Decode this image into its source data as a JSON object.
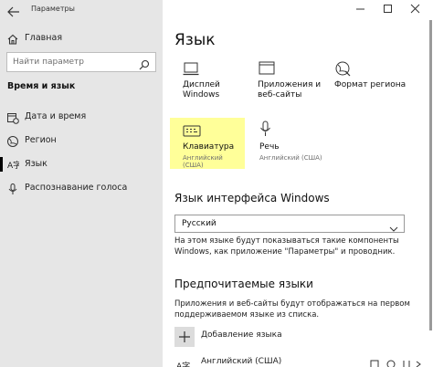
{
  "window": {
    "title": "Параметры",
    "controls": {
      "minimize": "minimize-icon",
      "maximize": "maximize-icon",
      "close": "close-icon"
    }
  },
  "sidebar": {
    "home_label": "Главная",
    "search_placeholder": "Найти параметр",
    "section_title": "Время и язык",
    "items": [
      {
        "label": "Дата и время",
        "icon": "calendar-clock-icon"
      },
      {
        "label": "Регион",
        "icon": "globe-icon"
      },
      {
        "label": "Язык",
        "icon": "language-icon",
        "active": true
      },
      {
        "label": "Распознавание голоса",
        "icon": "microphone-icon"
      }
    ]
  },
  "main": {
    "title": "Язык",
    "tiles": [
      {
        "label": "Дисплей Windows",
        "sub": "",
        "icon": "monitor-icon"
      },
      {
        "label": "Приложения и веб-сайты",
        "sub": "",
        "icon": "app-window-icon"
      },
      {
        "label": "Формат региона",
        "sub": "",
        "icon": "region-globe-icon"
      },
      {
        "label": "Клавиатура",
        "sub": "Английский (США)",
        "icon": "keyboard-icon",
        "highlighted": true
      },
      {
        "label": "Речь",
        "sub": "Английский (США)",
        "icon": "microphone-icon"
      }
    ],
    "ui_lang_title": "Язык интерфейса Windows",
    "ui_lang_value": "Русский",
    "ui_lang_desc": "На этом языке будут показываться такие компоненты Windows, как приложение \"Параметры\" и проводник.",
    "preferred_title": "Предпочитаемые языки",
    "preferred_desc": "Приложения и веб-сайты будут отображаться на первом поддерживаемом языке из списка.",
    "add_label": "Добавление языка",
    "languages": [
      {
        "label": "Английский (США)"
      }
    ]
  },
  "colors": {
    "sidebar_bg": "#e6e6e6",
    "highlight": "#ffff99",
    "accent": "#000000"
  }
}
